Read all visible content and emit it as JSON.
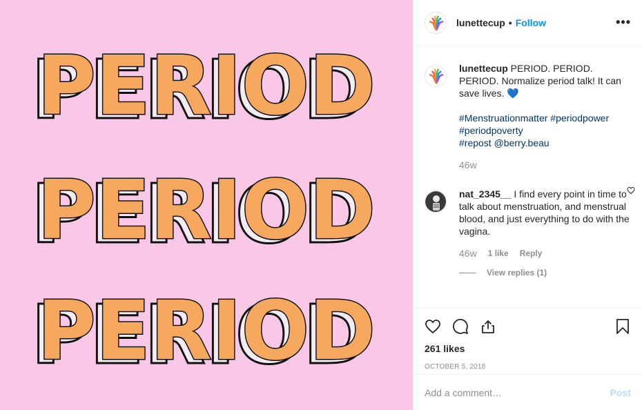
{
  "colors": {
    "media_background": "#f8c8e6",
    "letter_fill": "#f6a95e",
    "letter_side": "#f3ecf2",
    "follow_blue": "#0095f6",
    "hashtag_blue": "#00376b",
    "muted_gray": "#8e8e8e"
  },
  "media": {
    "words": [
      "PERIOD",
      "PERIOD",
      "PERIOD"
    ]
  },
  "header": {
    "username": "lunettecup",
    "separator": "•",
    "follow_label": "Follow",
    "more_icon": "more-horizontal-icon"
  },
  "caption": {
    "username": "lunettecup",
    "text": "PERIOD. PERIOD. PERIOD. Normalize period talk! It can save lives. 💙",
    "hashtags": [
      "#Menstruationmatter",
      "#periodpower",
      "#periodpoverty",
      "#repost",
      "@berry.beau"
    ],
    "time": "46w"
  },
  "comment": {
    "username": "nat_2345__",
    "text": "I find every point in time to talk about menstruation, and menstrual blood, and just everything to do with the vagina.",
    "time": "46w",
    "likes": "1 like",
    "reply_label": "Reply",
    "view_replies": "View replies (1)"
  },
  "actions": {
    "icons": [
      "heart-icon",
      "comment-icon",
      "share-icon",
      "bookmark-icon"
    ],
    "likes_count": "261 likes",
    "date": "OCTOBER 5, 2018"
  },
  "add_comment": {
    "placeholder": "Add a comment…",
    "post_label": "Post"
  }
}
